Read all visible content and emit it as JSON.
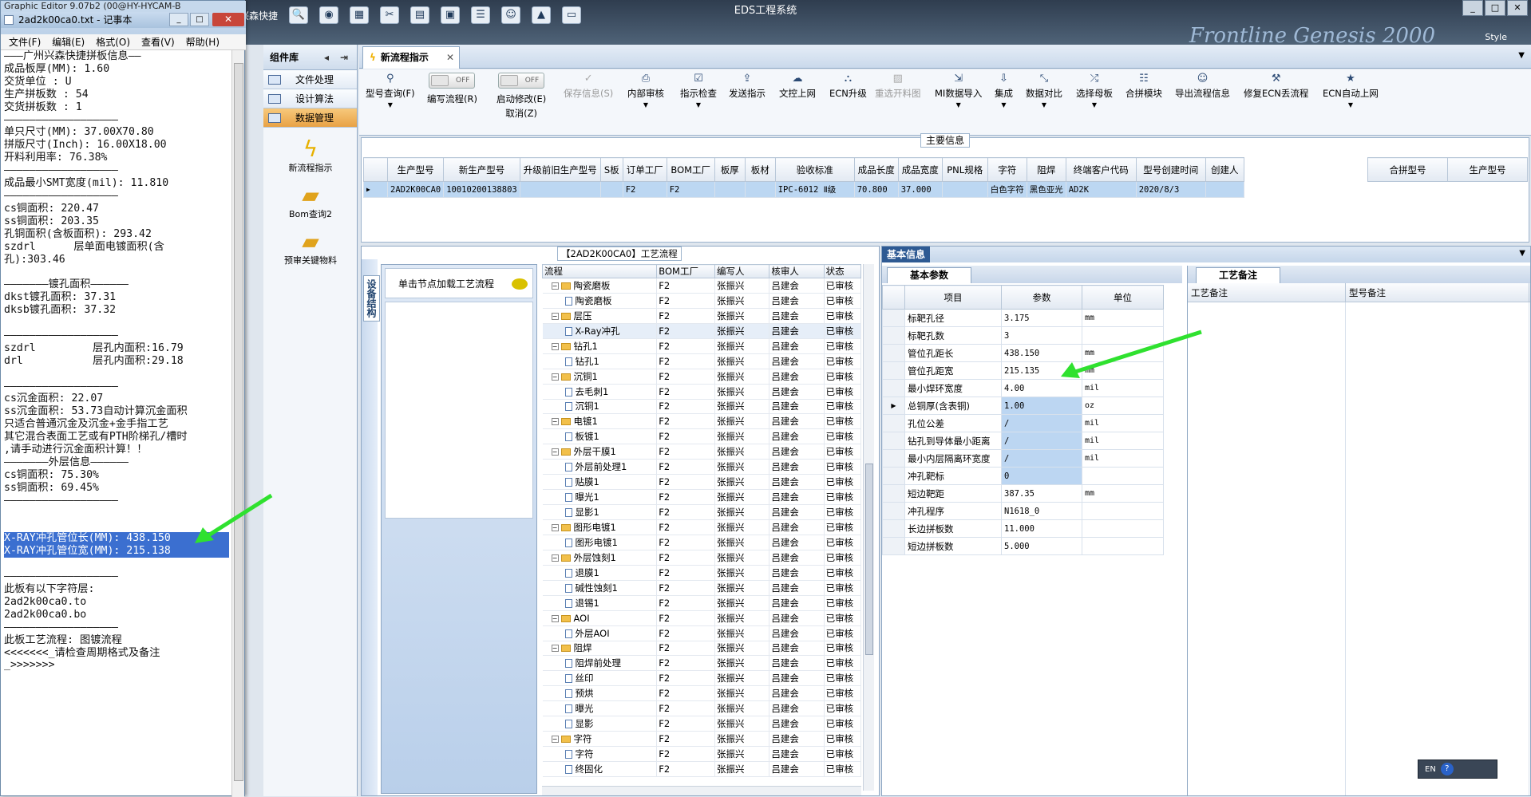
{
  "app": {
    "title": "EDS工程系统",
    "style_label": "Style",
    "brand": "Frontline Genesis 2000",
    "bg_app_title": "Graphic Editor 9.07b2 (00@HY-HYCAM-B",
    "bg_menu": "兴森快捷"
  },
  "notepad": {
    "title": "2ad2k00ca0.txt - 记事本",
    "menu": [
      "文件(F)",
      "编辑(E)",
      "格式(O)",
      "查看(V)",
      "帮助(H)"
    ],
    "lines": [
      "———广州兴森快捷拼板信息——",
      "成品板厚(MM): 1.60",
      "交货单位 : U",
      "生产拼板数 : 54",
      "交货拼板数 : 1",
      "——————————————————",
      "单只尺寸(MM): 37.00X70.80",
      "拼版尺寸(Inch): 16.00X18.00",
      "开料利用率: 76.38%",
      "——————————————————",
      "成品最小SMT宽度(mil): 11.810",
      "——————————————————",
      "cs铜面积: 220.47",
      "ss铜面积: 203.35",
      "孔铜面积(含板面积): 293.42",
      "szdrl      层单面电镀面积(含",
      "孔):303.46",
      "",
      "———————镀孔面积——————",
      "dkst镀孔面积: 37.31",
      "dksb镀孔面积: 37.32",
      "",
      "——————————————————",
      "szdrl         层孔内面积:16.79",
      "drl           层孔内面积:29.18",
      "",
      "——————————————————",
      "cs沉金面积: 22.07",
      "ss沉金面积: 53.73自动计算沉金面积",
      "只适合普通沉金及沉金+金手指工艺",
      "其它混合表面工艺或有PTH阶梯孔/槽时",
      ",请手动进行沉金面积计算！！",
      "———————外层信息——————",
      "cs铜面积: 75.30%",
      "ss铜面积: 69.45%",
      "——————————————————",
      "",
      "",
      "X-RAY冲孔管位长(MM): 438.150",
      "X-RAY冲孔管位宽(MM): 215.138",
      "",
      "——————————————————",
      "此板有以下字符层:",
      "2ad2k00ca0.to",
      "2ad2k00ca0.bo",
      "——————————————————",
      "此板工艺流程: 图镀流程",
      "<<<<<<<_请检查周期格式及备注",
      "_>>>>>>>"
    ]
  },
  "components": {
    "title": "组件库",
    "items": [
      "文件处理",
      "设计算法",
      "数据管理"
    ],
    "tools": [
      "新流程指示",
      "Bom查询2",
      "预审关键物料"
    ]
  },
  "tabs": {
    "active": "新流程指示"
  },
  "ribbon": {
    "buttons": [
      {
        "label": "型号查询(F)",
        "icon": "magnifier-icon"
      },
      {
        "label": "编写流程(R)",
        "toggle": "OFF"
      },
      {
        "label": "启动修改(E)",
        "toggle": "OFF",
        "sub": "取消(Z)"
      },
      {
        "label": "保存信息(S)",
        "disabled": true
      },
      {
        "label": "内部审核"
      },
      {
        "label": "指示检查"
      },
      {
        "label": "发送指示"
      },
      {
        "label": "文控上网"
      },
      {
        "label": "ECN升级"
      },
      {
        "label": "重选开料图",
        "disabled": true
      },
      {
        "label": "MI数据导入"
      },
      {
        "label": "集成"
      },
      {
        "label": "数据对比"
      },
      {
        "label": "选择母板"
      },
      {
        "label": "合拼模块"
      },
      {
        "label": "导出流程信息"
      },
      {
        "label": "修复ECN丢流程"
      },
      {
        "label": "ECN自动上网"
      }
    ]
  },
  "main_info": {
    "caption": "主要信息",
    "columns": [
      "生产型号",
      "新生产型号",
      "升级前旧生产型号",
      "S板",
      "订单工厂",
      "BOM工厂",
      "板厚",
      "板材",
      "验收标准",
      "成品长度",
      "成品宽度",
      "PNL规格",
      "字符",
      "阻焊",
      "终端客户代码",
      "型号创建时间",
      "创建人"
    ],
    "row": [
      "2AD2K00CA0",
      "10010200138803",
      "",
      "",
      "F2",
      "F2",
      "",
      "",
      "IPC-6012 Ⅱ级",
      "70.800",
      "37.000",
      "",
      "白色字符",
      "黑色亚光",
      "AD2K",
      "2020/8/3",
      ""
    ],
    "side_columns": [
      "合拼型号",
      "生产型号"
    ]
  },
  "flow": {
    "caption": "【2AD2K00CA0】工艺流程",
    "side_tab": "设备结构",
    "hint": "单击节点加载工艺流程",
    "columns": [
      "流程",
      "BOM工厂",
      "编写人",
      "核审人",
      "状态"
    ],
    "rows": [
      {
        "name": "陶瓷磨板",
        "lvl": 0,
        "f": "F2",
        "w": "张振兴",
        "c": "吕建会",
        "s": "已审核"
      },
      {
        "name": "陶瓷磨板",
        "lvl": 1,
        "f": "F2",
        "w": "张振兴",
        "c": "吕建会",
        "s": "已审核"
      },
      {
        "name": "层压",
        "lvl": 0,
        "f": "F2",
        "w": "张振兴",
        "c": "吕建会",
        "s": "已审核"
      },
      {
        "name": "X-Ray冲孔",
        "lvl": 1,
        "f": "F2",
        "w": "张振兴",
        "c": "吕建会",
        "s": "已审核",
        "hl": true
      },
      {
        "name": "钻孔1",
        "lvl": 0,
        "f": "F2",
        "w": "张振兴",
        "c": "吕建会",
        "s": "已审核"
      },
      {
        "name": "钻孔1",
        "lvl": 1,
        "f": "F2",
        "w": "张振兴",
        "c": "吕建会",
        "s": "已审核"
      },
      {
        "name": "沉铜1",
        "lvl": 0,
        "f": "F2",
        "w": "张振兴",
        "c": "吕建会",
        "s": "已审核"
      },
      {
        "name": "去毛刺1",
        "lvl": 1,
        "f": "F2",
        "w": "张振兴",
        "c": "吕建会",
        "s": "已审核"
      },
      {
        "name": "沉铜1",
        "lvl": 1,
        "f": "F2",
        "w": "张振兴",
        "c": "吕建会",
        "s": "已审核"
      },
      {
        "name": "电镀1",
        "lvl": 0,
        "f": "F2",
        "w": "张振兴",
        "c": "吕建会",
        "s": "已审核"
      },
      {
        "name": "板镀1",
        "lvl": 1,
        "f": "F2",
        "w": "张振兴",
        "c": "吕建会",
        "s": "已审核"
      },
      {
        "name": "外层干膜1",
        "lvl": 0,
        "f": "F2",
        "w": "张振兴",
        "c": "吕建会",
        "s": "已审核"
      },
      {
        "name": "外层前处理1",
        "lvl": 1,
        "f": "F2",
        "w": "张振兴",
        "c": "吕建会",
        "s": "已审核"
      },
      {
        "name": "贴膜1",
        "lvl": 1,
        "f": "F2",
        "w": "张振兴",
        "c": "吕建会",
        "s": "已审核"
      },
      {
        "name": "曝光1",
        "lvl": 1,
        "f": "F2",
        "w": "张振兴",
        "c": "吕建会",
        "s": "已审核"
      },
      {
        "name": "显影1",
        "lvl": 1,
        "f": "F2",
        "w": "张振兴",
        "c": "吕建会",
        "s": "已审核"
      },
      {
        "name": "图形电镀1",
        "lvl": 0,
        "f": "F2",
        "w": "张振兴",
        "c": "吕建会",
        "s": "已审核"
      },
      {
        "name": "图形电镀1",
        "lvl": 1,
        "f": "F2",
        "w": "张振兴",
        "c": "吕建会",
        "s": "已审核"
      },
      {
        "name": "外层蚀刻1",
        "lvl": 0,
        "f": "F2",
        "w": "张振兴",
        "c": "吕建会",
        "s": "已审核"
      },
      {
        "name": "退膜1",
        "lvl": 1,
        "f": "F2",
        "w": "张振兴",
        "c": "吕建会",
        "s": "已审核"
      },
      {
        "name": "碱性蚀刻1",
        "lvl": 1,
        "f": "F2",
        "w": "张振兴",
        "c": "吕建会",
        "s": "已审核"
      },
      {
        "name": "退锡1",
        "lvl": 1,
        "f": "F2",
        "w": "张振兴",
        "c": "吕建会",
        "s": "已审核"
      },
      {
        "name": "AOI",
        "lvl": 0,
        "f": "F2",
        "w": "张振兴",
        "c": "吕建会",
        "s": "已审核"
      },
      {
        "name": "外层AOI",
        "lvl": 1,
        "f": "F2",
        "w": "张振兴",
        "c": "吕建会",
        "s": "已审核"
      },
      {
        "name": "阻焊",
        "lvl": 0,
        "f": "F2",
        "w": "张振兴",
        "c": "吕建会",
        "s": "已审核"
      },
      {
        "name": "阻焊前处理",
        "lvl": 1,
        "f": "F2",
        "w": "张振兴",
        "c": "吕建会",
        "s": "已审核"
      },
      {
        "name": "丝印",
        "lvl": 1,
        "f": "F2",
        "w": "张振兴",
        "c": "吕建会",
        "s": "已审核"
      },
      {
        "name": "预烘",
        "lvl": 1,
        "f": "F2",
        "w": "张振兴",
        "c": "吕建会",
        "s": "已审核"
      },
      {
        "name": "曝光",
        "lvl": 1,
        "f": "F2",
        "w": "张振兴",
        "c": "吕建会",
        "s": "已审核"
      },
      {
        "name": "显影",
        "lvl": 1,
        "f": "F2",
        "w": "张振兴",
        "c": "吕建会",
        "s": "已审核"
      },
      {
        "name": "字符",
        "lvl": 0,
        "f": "F2",
        "w": "张振兴",
        "c": "吕建会",
        "s": "已审核"
      },
      {
        "name": "字符",
        "lvl": 1,
        "f": "F2",
        "w": "张振兴",
        "c": "吕建会",
        "s": "已审核"
      },
      {
        "name": "终固化",
        "lvl": 1,
        "f": "F2",
        "w": "张振兴",
        "c": "吕建会",
        "s": "已审核"
      }
    ]
  },
  "basic": {
    "title": "基本信息",
    "tab": "基本参数",
    "columns": [
      "项目",
      "参数",
      "单位"
    ],
    "rows": [
      {
        "item": "标靶孔径",
        "val": "3.175",
        "unit": "mm"
      },
      {
        "item": "标靶孔数",
        "val": "3",
        "unit": ""
      },
      {
        "item": "管位孔距长",
        "val": "438.150",
        "unit": "mm"
      },
      {
        "item": "管位孔距宽",
        "val": "215.135",
        "unit": "mm"
      },
      {
        "item": "最小焊环宽度",
        "val": "4.00",
        "unit": "mil"
      },
      {
        "item": "总铜厚(含表铜)",
        "val": "1.00",
        "unit": "oz",
        "blue": true,
        "cur": true
      },
      {
        "item": "孔位公差",
        "val": "/",
        "unit": "mil",
        "blue": true
      },
      {
        "item": "钻孔到导体最小距离",
        "val": "/",
        "unit": "mil",
        "blue": true
      },
      {
        "item": "最小内层隔离环宽度",
        "val": "/",
        "unit": "mil",
        "blue": true
      },
      {
        "item": "冲孔靶标",
        "val": "0",
        "unit": "",
        "blue": true
      },
      {
        "item": "短边靶距",
        "val": "387.35",
        "unit": "mm"
      },
      {
        "item": "冲孔程序",
        "val": "N1618_0",
        "unit": ""
      },
      {
        "item": "长边拼板数",
        "val": "11.000",
        "unit": ""
      },
      {
        "item": "短边拼板数",
        "val": "5.000",
        "unit": ""
      }
    ],
    "note_tab": "工艺备注",
    "note_columns": [
      "工艺备注",
      "型号备注"
    ]
  },
  "ime": {
    "lang": "EN",
    "help": "?"
  }
}
